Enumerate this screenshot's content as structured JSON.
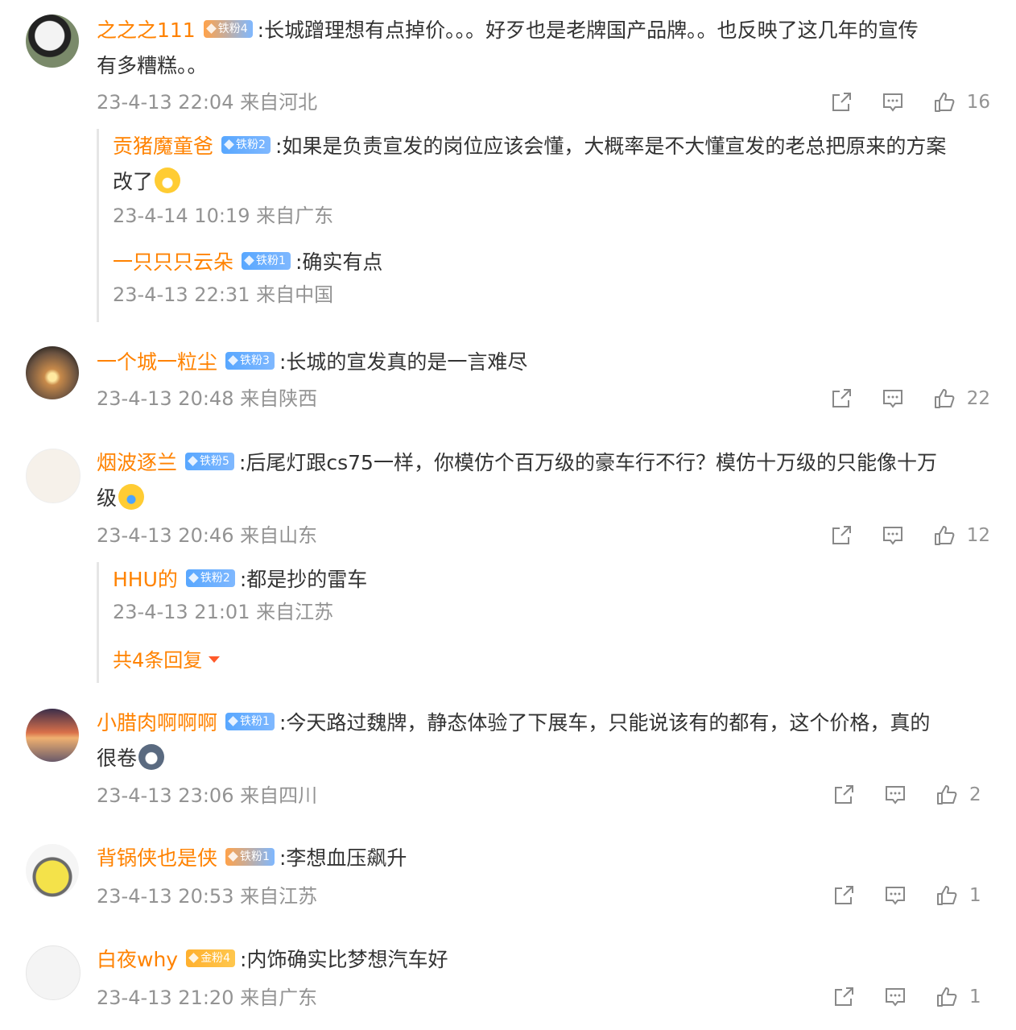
{
  "comments": [
    {
      "name": "之之之111",
      "badge": "铁粉4",
      "text": ":长城蹭理想有点掉价。。。好歹也是老牌国产品牌。。也反映了这几年的宣传",
      "text2": "有多糟糕。。",
      "meta": "23-4-13 22:04 来自河北",
      "likes": "16",
      "replies": [
        {
          "name": "贡猪魔童爸",
          "badge": "铁粉2",
          "text": ":如果是负责宣发的岗位应该会懂，大概率是不大懂宣发的老总把原来的方案",
          "text2": "改了",
          "meta": "23-4-14 10:19 来自广东"
        },
        {
          "name": "一只只只云朵",
          "badge": "铁粉1",
          "text": ":确实有点",
          "meta": "23-4-13 22:31 来自中国"
        }
      ]
    },
    {
      "name": "一个城一粒尘",
      "badge": "铁粉3",
      "text": ":长城的宣发真的是一言难尽",
      "meta": "23-4-13 20:48 来自陕西",
      "likes": "22"
    },
    {
      "name": "烟波逐兰",
      "badge": "铁粉5",
      "text": ":后尾灯跟cs75一样，你模仿个百万级的豪车行不行？模仿十万级的只能像十万",
      "text2": "级",
      "meta": "23-4-13 20:46 来自山东",
      "likes": "12",
      "replies": [
        {
          "name": "HHU的",
          "badge": "铁粉2",
          "text": ":都是抄的雷车",
          "meta": "23-4-13 21:01 来自江苏"
        }
      ],
      "more_replies": "共4条回复"
    },
    {
      "name": "小腊肉啊啊啊",
      "badge": "铁粉1",
      "text": ":今天路过魏牌，静态体验了下展车，只能说该有的都有，这个价格，真的",
      "text2": "很卷",
      "meta": "23-4-13 23:06 来自四川",
      "likes": "2"
    },
    {
      "name": "背锅侠也是侠",
      "badge": "铁粉1",
      "text": ":李想血压飙升",
      "meta": "23-4-13 20:53 来自江苏",
      "likes": "1"
    },
    {
      "name": "白夜why",
      "badge": "金粉4",
      "text": ":内饰确实比梦想汽车好",
      "meta": "23-4-13 21:20 来自广东",
      "likes": "1"
    }
  ],
  "colors": {
    "name": "#ff8200",
    "meta": "#939393",
    "text": "#333333"
  },
  "icons": [
    "share-icon",
    "comment-icon",
    "like-icon"
  ]
}
